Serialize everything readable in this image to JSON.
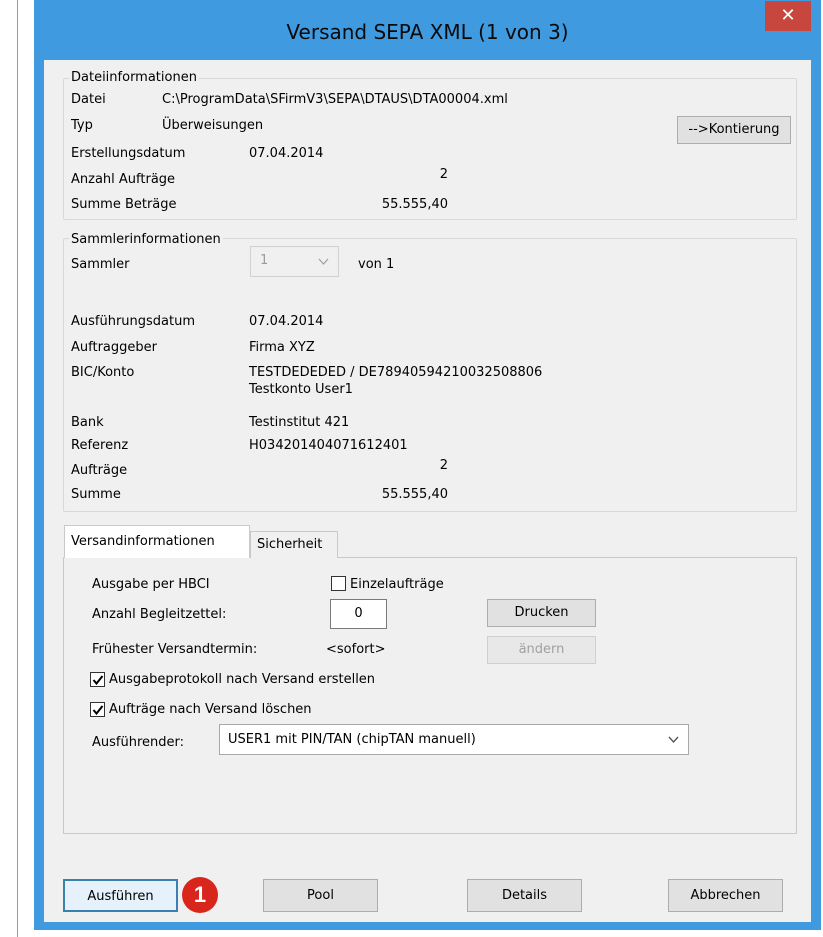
{
  "window": {
    "title": "Versand SEPA XML (1 von 3)",
    "close_label": "✕"
  },
  "datei": {
    "legend": "Dateiinformationen",
    "datei_label": "Datei",
    "datei_value": "C:\\ProgramData\\SFirmV3\\SEPA\\DTAUS\\DTA00004.xml",
    "typ_label": "Typ",
    "typ_value": "Überweisungen",
    "erstellung_label": "Erstellungsdatum",
    "erstellung_value": "07.04.2014",
    "anzahl_label": "Anzahl Aufträge",
    "anzahl_value": "2",
    "summe_label": "Summe Beträge",
    "summe_value": "55.555,40",
    "kontierung_button": "-->Kontierung"
  },
  "sammler": {
    "legend": "Sammlerinformationen",
    "sammler_label": "Sammler",
    "sammler_value": "1",
    "von_label": "von 1",
    "ausfuehrung_label": "Ausführungsdatum",
    "ausfuehrung_value": "07.04.2014",
    "auftraggeber_label": "Auftraggeber",
    "auftraggeber_value": "Firma XYZ",
    "bic_label": "BIC/Konto",
    "bic_value": "TESTDEDEDED / DE78940594210032508806",
    "konto_name": "Testkonto User1",
    "bank_label": "Bank",
    "bank_value": "Testinstitut 421",
    "referenz_label": "Referenz",
    "referenz_value": "H034201404071612401",
    "auftraege_label": "Aufträge",
    "auftraege_value": "2",
    "summe_label": "Summe",
    "summe_value": "55.555,40"
  },
  "tabs": [
    {
      "label": "Versandinformationen",
      "active": true
    },
    {
      "label": "Sicherheit",
      "active": false
    }
  ],
  "versand": {
    "ausgabe_label": "Ausgabe per HBCI",
    "einzel_label": "Einzelaufträge",
    "einzel_checked": false,
    "begleit_label": "Anzahl Begleitzettel:",
    "begleit_value": "0",
    "drucken_button": "Drucken",
    "termin_label": "Frühester Versandtermin:",
    "termin_value": "<sofort>",
    "aendern_button": "ändern",
    "protokoll_label": "Ausgabeprotokoll nach Versand erstellen",
    "protokoll_checked": true,
    "loeschen_label": "Aufträge nach Versand löschen",
    "loeschen_checked": true,
    "ausfuehrender_label": "Ausführender:",
    "ausfuehrender_value": "USER1 mit PIN/TAN (chipTAN manuell)"
  },
  "buttons": {
    "ausfuehren": "Ausführen",
    "pool": "Pool",
    "details": "Details",
    "abbrechen": "Abbrechen"
  },
  "annotation": {
    "badge": "1"
  }
}
